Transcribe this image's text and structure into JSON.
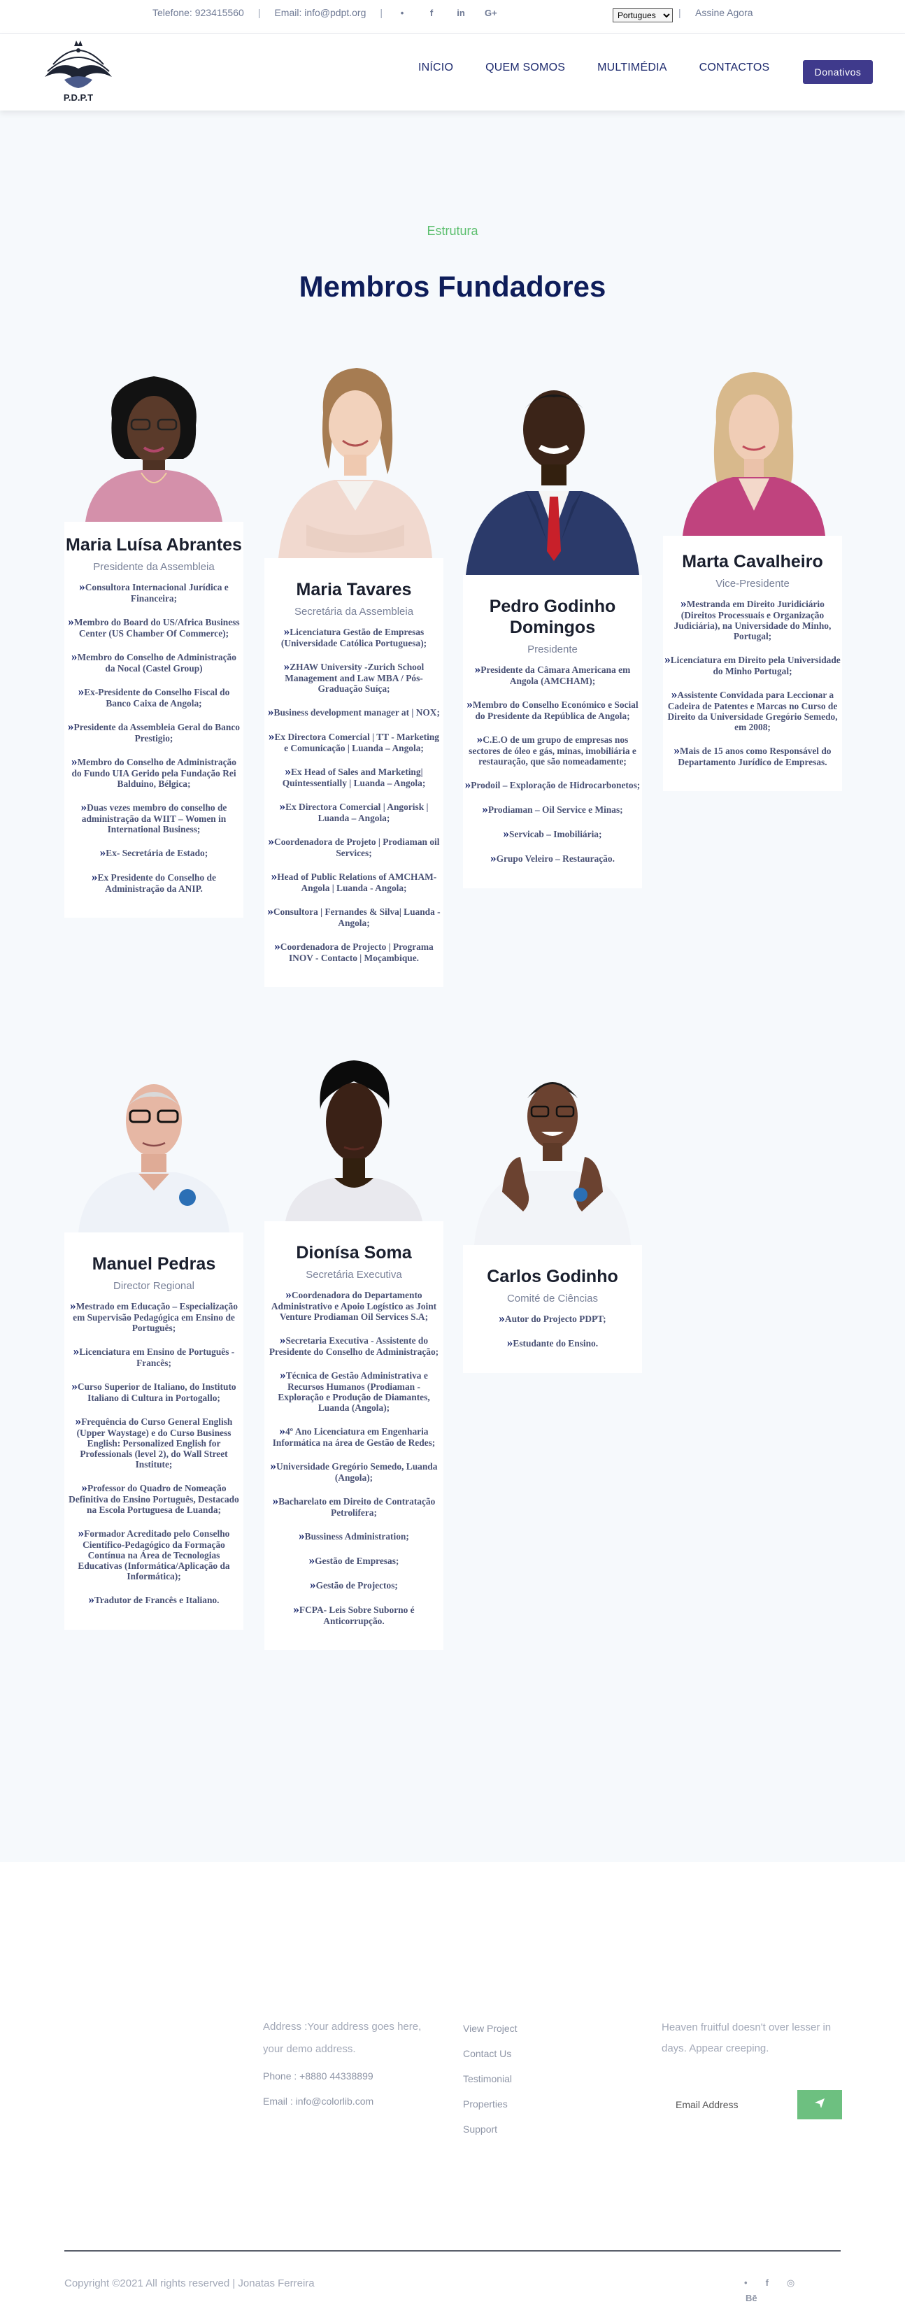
{
  "topbar": {
    "phone": "Telefone: 923415560",
    "email": "Email: info@pdpt.org",
    "social_icons": [
      "twitter-icon",
      "facebook-icon",
      "linkedin-icon",
      "google-plus-icon"
    ],
    "social_glyphs": [
      "•",
      "f",
      "in",
      "G+"
    ],
    "language": "Portugues",
    "signup": "Assine Agora"
  },
  "header": {
    "logo_text": "P.D.P.T",
    "nav": [
      "INÍCIO",
      "QUEM SOMOS",
      "MULTIMÉDIA",
      "CONTACTOS"
    ],
    "donate": "Donativos"
  },
  "section": {
    "eyebrow": "Estrutura",
    "title": "Membros Fundadores"
  },
  "members": [
    {
      "name": "Maria Luísa Abrantes",
      "role": "Presidente da Assembleia",
      "items": [
        "Consultora Internacional Jurídica e Financeira;",
        "Membro do Board do US/Africa Business Center (US Chamber Of Commerce);",
        "Membro do Conselho de Administração da Nocal (Castel Group)",
        "Ex-Presidente do Conselho Fiscal do Banco Caixa de Angola;",
        "Presidente da Assembleia Geral do Banco Prestigio;",
        "Membro do Conselho de Administração do Fundo UIA Gerido pela Fundação Rei Balduino, Bélgica;",
        "Duas vezes membro do conselho de administração da WIIT – Women in International Business;",
        "Ex- Secretária de Estado;",
        "Ex Presidente do Conselho de Administração da ANIP."
      ]
    },
    {
      "name": "Maria Tavares",
      "role": "Secretária da Assembleia",
      "items": [
        "Licenciatura Gestão de Empresas (Universidade Católica Portuguesa);",
        "ZHAW University -Zurich School Management and Law MBA / Pós-Graduação Suíça;",
        "Business development manager at | NOX;",
        "Ex Directora Comercial | TT - Marketing e Comunicação | Luanda – Angola;",
        "Ex Head of Sales and Marketing| Quintessentially | Luanda – Angola;",
        "Ex Directora Comercial | Angorisk | Luanda – Angola;",
        "Coordenadora de Projeto | Prodiaman oil Services;",
        "Head of Public Relations of AMCHAM- Angola | Luanda - Angola;",
        "Consultora | Fernandes & Silva| Luanda - Angola;",
        "Coordenadora de Projecto | Programa INOV - Contacto | Moçambique."
      ]
    },
    {
      "name": "Pedro Godinho Domingos",
      "role": "Presidente",
      "items": [
        "Presidente da Câmara Americana em Angola (AMCHAM);",
        "Membro do Conselho Económico e Social do Presidente da República de Angola;",
        "C.E.O de um grupo de empresas nos sectores de óleo e gás, minas, imobiliária e restauração, que são nomeadamente;",
        "Prodoil – Exploração de Hidrocarbonetos;",
        "Prodiaman – Oil Service e Minas;",
        "Servicab – Imobiliária;",
        "Grupo Veleiro – Restauração."
      ]
    },
    {
      "name": "Marta Cavalheiro",
      "role": "Vice-Presidente",
      "items": [
        "Mestranda em Direito Juridiciário (Direitos Processuais e Organização Judiciária), na Universidade do Minho, Portugal;",
        "Licenciatura em Direito pela Universidade do Minho Portugal;",
        "Assistente Convidada para Leccionar a Cadeira de Patentes e Marcas no Curso de Direito da Universidade Gregório Semedo, em 2008;",
        "Mais de 15 anos como Responsável do Departamento Jurídico de Empresas."
      ]
    },
    {
      "name": "Manuel Pedras",
      "role": "Director Regional",
      "items": [
        "Mestrado em Educação – Especialização em Supervisão Pedagógica em Ensino de Português;",
        "Licenciatura em Ensino de Português - Francês;",
        "Curso Superior de Italiano, do Instituto Italiano di Cultura in Portogallo;",
        "Frequência do Curso General English (Upper Waystage) e do Curso Business English: Personalized English for Professionals (level 2), do Wall Street Institute;",
        "Professor do Quadro de Nomeação Definitiva do Ensino Português, Destacado na Escola Portuguesa de Luanda;",
        "Formador Acreditado pelo Conselho Científico-Pedagógico da Formação Contínua na Área de Tecnologias Educativas (Informática/Aplicação da Informática);",
        "Tradutor de Francês e Italiano."
      ]
    },
    {
      "name": "Dionísa Soma",
      "role": "Secretária Executiva",
      "items": [
        "Coordenadora do Departamento Administrativo e Apoio Logístico as Joint Venture Prodiaman Oil Services S.A;",
        "Secretaria Executiva - Assistente do Presidente do Conselho de Administração;",
        "Técnica de Gestão Administrativa e Recursos Humanos (Prodiaman - Exploração e Produção de Diamantes, Luanda (Angola);",
        "4º Ano Licenciatura em Engenharia Informática na área de Gestão de Redes;",
        "Universidade Gregório Semedo, Luanda (Angola);",
        "Bacharelato em Direito de Contratação Petrolifera;",
        "Bussiness Administration;",
        "Gestão de Empresas;",
        "Gestão de Projectos;",
        "FCPA- Leis Sobre Suborno é Anticorrupção."
      ]
    },
    {
      "name": "Carlos Godinho",
      "role": "Comité de Ciências",
      "items": [
        "Autor do Projecto PDPT;",
        "Estudante do Ensino."
      ]
    }
  ],
  "footer": {
    "address_lines": [
      "Address :Your address goes here,",
      "your demo address."
    ],
    "phone": "Phone : +8880 44338899",
    "email": "Email : info@colorlib.com",
    "links": [
      "View Project",
      "Contact Us",
      "Testimonial",
      "Properties",
      "Support"
    ],
    "tagline": "Heaven fruitful doesn't over lesser in days. Appear creeping.",
    "newsletter_placeholder": "Email Address",
    "copyright": "Copyright ©2021 All rights reserved | Jonatas Ferreira",
    "social_glyphs": [
      "•",
      "f",
      "◎"
    ],
    "behance": "Bē"
  },
  "colors": {
    "accent_green": "#5cbf6e",
    "title_navy": "#0e1d5a",
    "donate_purple": "#3f3a8c",
    "section_bg": "#f6f9fc"
  }
}
